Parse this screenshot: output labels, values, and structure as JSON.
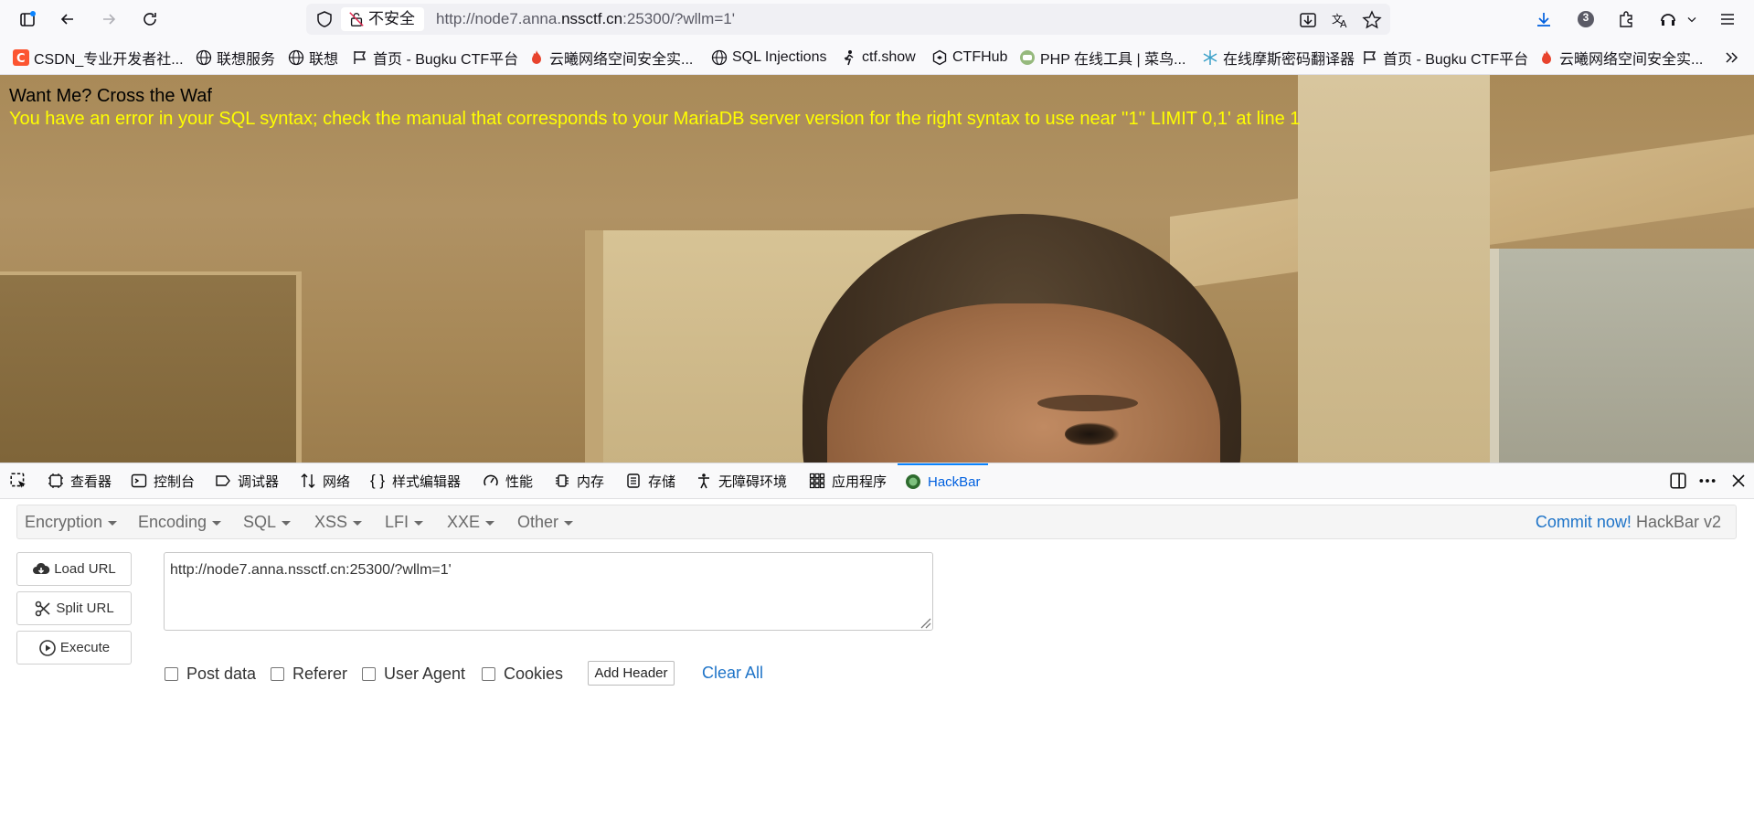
{
  "browser": {
    "security_label": "不安全",
    "url_prefix": "http://node7.anna.",
    "url_domain": "nssctf.cn",
    "url_suffix": ":25300/?wllm=1'",
    "downloads_badge": "3"
  },
  "bookmarks": [
    {
      "label": "CSDN_专业开发者社...",
      "icon": "csdn-icon"
    },
    {
      "label": "联想服务",
      "icon": "globe-icon"
    },
    {
      "label": "联想",
      "icon": "globe-icon"
    },
    {
      "label": "首页 - Bugku CTF平台",
      "icon": "flag-icon"
    },
    {
      "label": "云曦网络空间安全实...",
      "icon": "fire-icon"
    },
    {
      "label": "SQL Injections",
      "icon": "globe-icon"
    },
    {
      "label": "ctf.show",
      "icon": "runner-icon"
    },
    {
      "label": "CTFHub",
      "icon": "hex-icon"
    },
    {
      "label": "PHP 在线工具 | 菜鸟...",
      "icon": "runoob-icon"
    },
    {
      "label": "在线摩斯密码翻译器",
      "icon": "snowflake-icon"
    },
    {
      "label": "首页 - Bugku CTF平台",
      "icon": "flag-icon"
    },
    {
      "label": "云曦网络空间安全实...",
      "icon": "fire-icon"
    }
  ],
  "page": {
    "title": "Want Me? Cross the Waf",
    "error": "You have an error in your SQL syntax; check the manual that corresponds to your MariaDB server version for the right syntax to use near ''1'' LIMIT 0,1' at line 1"
  },
  "devtools": {
    "tabs": [
      "查看器",
      "控制台",
      "调试器",
      "网络",
      "样式编辑器",
      "性能",
      "内存",
      "存储",
      "无障碍环境",
      "应用程序",
      "HackBar"
    ],
    "active_tab": "HackBar"
  },
  "hackbar": {
    "menu": [
      "Encryption",
      "Encoding",
      "SQL",
      "XSS",
      "LFI",
      "XXE",
      "Other"
    ],
    "commit_link": "Commit now!",
    "version": "HackBar v2",
    "load_url": "Load URL",
    "split_url": "Split URL",
    "execute": "Execute",
    "url_value": "http://node7.anna.nssctf.cn:25300/?wllm=1'",
    "options": [
      "Post data",
      "Referer",
      "User Agent",
      "Cookies"
    ],
    "add_header": "Add Header",
    "clear_all": "Clear All"
  },
  "colors": {
    "accent": "#0a84ff",
    "error_text": "#ffff00",
    "link": "#1f74c8"
  }
}
